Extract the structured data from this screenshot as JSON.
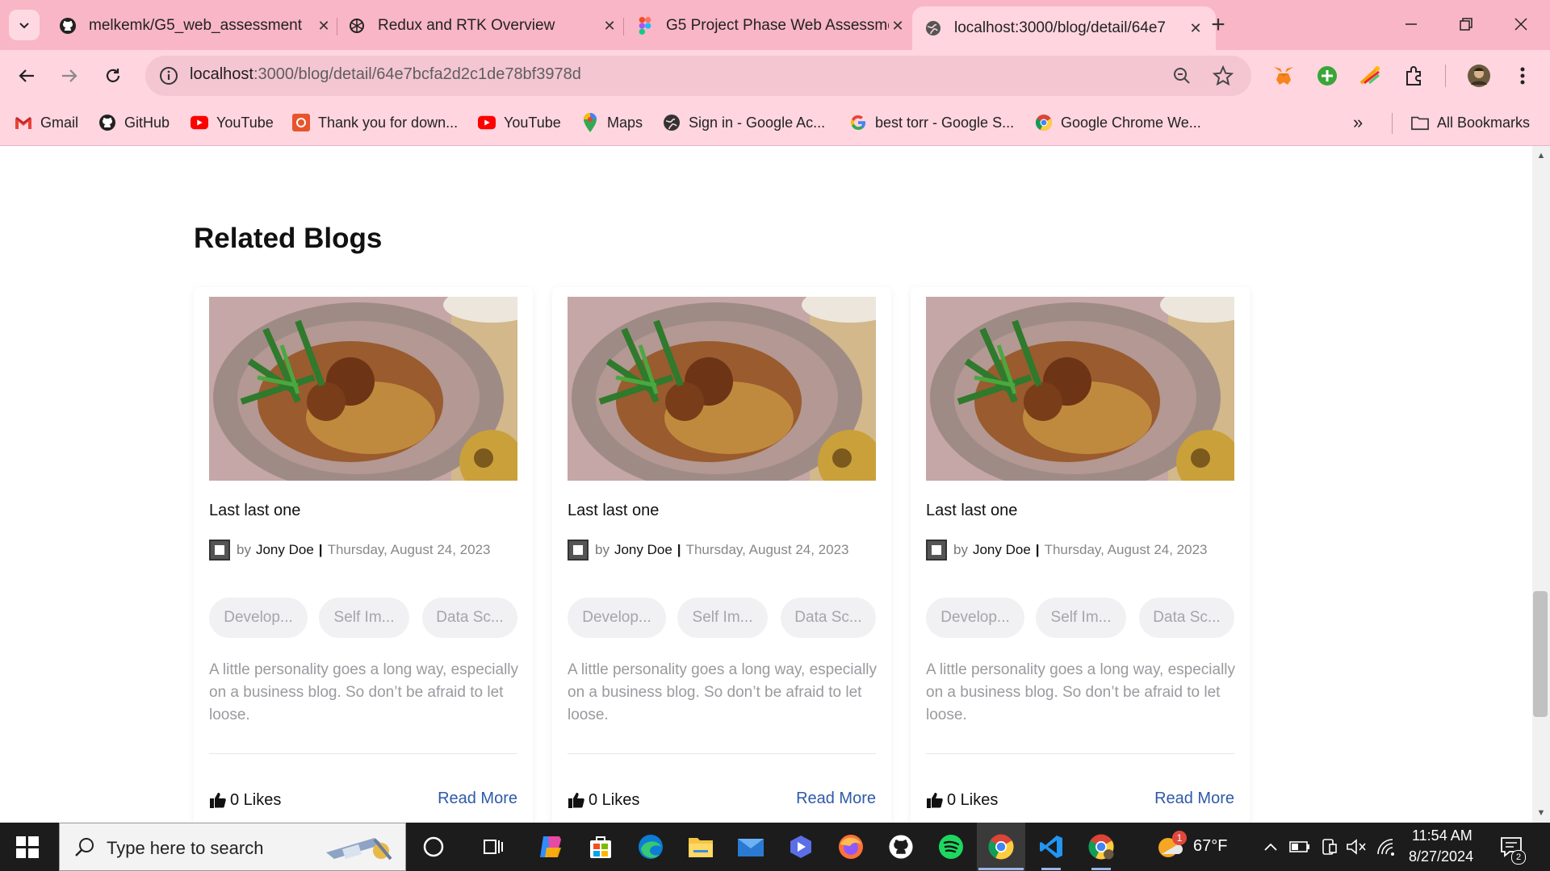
{
  "browser": {
    "tabs": [
      {
        "title": "melkemk/G5_web_assessment",
        "icon": "github-icon"
      },
      {
        "title": "Redux and RTK Overview",
        "icon": "chatgpt-icon"
      },
      {
        "title": "G5 Project Phase Web Assessme",
        "icon": "figma-icon"
      },
      {
        "title": "localhost:3000/blog/detail/64e7",
        "icon": "globe-icon"
      }
    ],
    "url_host": "localhost",
    "url_rest": ":3000/blog/detail/64e7bcfa2d2c1de78bf3978d",
    "bookmarks": [
      {
        "label": "Gmail",
        "icon": "gmail-icon"
      },
      {
        "label": "GitHub",
        "icon": "github-icon"
      },
      {
        "label": "YouTube",
        "icon": "youtube-icon"
      },
      {
        "label": "Thank you for down...",
        "icon": "download-site-icon"
      },
      {
        "label": "YouTube",
        "icon": "youtube-icon"
      },
      {
        "label": "Maps",
        "icon": "maps-icon"
      },
      {
        "label": "Sign in - Google Ac...",
        "icon": "globe-icon"
      },
      {
        "label": "best torr - Google S...",
        "icon": "google-icon"
      },
      {
        "label": "Google Chrome We...",
        "icon": "chrome-icon"
      }
    ],
    "all_bookmarks": "All Bookmarks"
  },
  "page": {
    "section_title": "Related Blogs",
    "cards": [
      {
        "title": "Last last one",
        "by": "by",
        "author": "Jony Doe",
        "date": "Thursday, August 24, 2023",
        "tags": [
          "Develop...",
          "Self Im...",
          "Data Sc..."
        ],
        "excerpt": "A little personality goes a long way, especially on a business blog. So don’t be afraid to let loose.",
        "likes": "0 Likes",
        "read_more": "Read More"
      },
      {
        "title": "Last last one",
        "by": "by",
        "author": "Jony Doe",
        "date": "Thursday, August 24, 2023",
        "tags": [
          "Develop...",
          "Self Im...",
          "Data Sc..."
        ],
        "excerpt": "A little personality goes a long way, especially on a business blog. So don’t be afraid to let loose.",
        "likes": "0 Likes",
        "read_more": "Read More"
      },
      {
        "title": "Last last one",
        "by": "by",
        "author": "Jony Doe",
        "date": "Thursday, August 24, 2023",
        "tags": [
          "Develop...",
          "Self Im...",
          "Data Sc..."
        ],
        "excerpt": "A little personality goes a long way, especially on a business blog. So don’t be afraid to let loose.",
        "likes": "0 Likes",
        "read_more": "Read More"
      }
    ]
  },
  "taskbar": {
    "search_placeholder": "Type here to search",
    "weather": "67°F",
    "time": "11:54 AM",
    "date": "8/27/2024",
    "weather_badge": "1",
    "notification_count": "2"
  },
  "colors": {
    "tab_strip": "#f9b6c6",
    "toolbar": "#ffd5df",
    "link": "#2e5aa8"
  }
}
